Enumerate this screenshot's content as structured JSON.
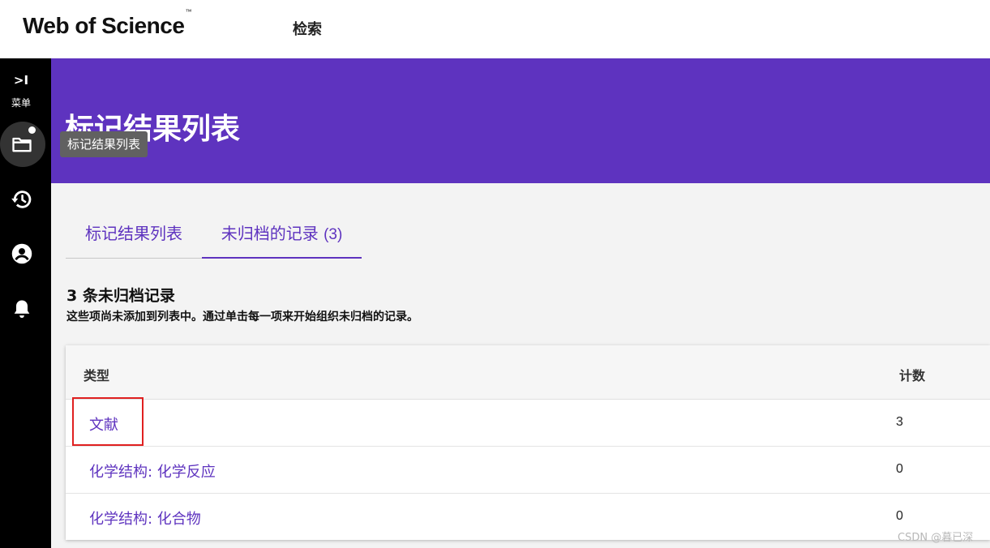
{
  "topbar": {
    "logo_text": "Web of Science",
    "logo_tm": "™",
    "nav_search": "检索"
  },
  "sidebar": {
    "expand_glyph": ">I",
    "menu_label": "菜单",
    "icons": [
      "folder-icon",
      "history-icon",
      "account-icon",
      "bell-icon"
    ]
  },
  "header": {
    "title": "标记结果列表",
    "tooltip": "标记结果列表"
  },
  "tabs": [
    {
      "label": "标记结果列表"
    },
    {
      "label": "未归档的记录",
      "count": "(3)",
      "active": true
    }
  ],
  "section": {
    "title": "3 条未归档记录",
    "description": "这些项尚未添加到列表中。通过单击每一项来开始组织未归档的记录。"
  },
  "table": {
    "headers": {
      "type": "类型",
      "count": "计数"
    },
    "rows": [
      {
        "type": "文献",
        "count": "3"
      },
      {
        "type": "化学结构: 化学反应",
        "count": "0"
      },
      {
        "type": "化学结构: 化合物",
        "count": "0"
      }
    ]
  },
  "watermark": "CSDN @暮已深",
  "colors": {
    "brand_purple": "#5e33bf",
    "sidebar_bg": "#000000",
    "highlight_red": "#e02020",
    "tooltip_bg": "#616161"
  }
}
